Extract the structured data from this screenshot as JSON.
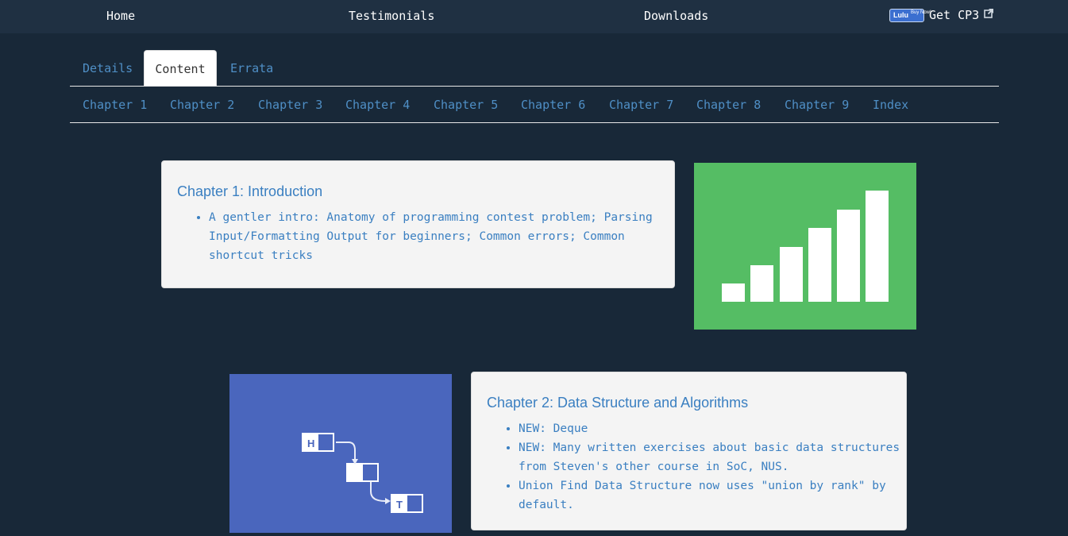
{
  "topnav": {
    "home": "Home",
    "testimonials": "Testimonials",
    "downloads": "Downloads",
    "lulu_logo": "Lulu",
    "lulu_buy": "Buy Now!",
    "get_cp3": "Get CP3",
    "external_icon": "external-link-icon"
  },
  "tabs": [
    "Details",
    "Content",
    "Errata"
  ],
  "active_tab": "Content",
  "chapters": [
    "Chapter 1",
    "Chapter 2",
    "Chapter 3",
    "Chapter 4",
    "Chapter 5",
    "Chapter 6",
    "Chapter 7",
    "Chapter 8",
    "Chapter 9",
    "Index"
  ],
  "chapter1": {
    "title": "Chapter 1: Introduction",
    "items": [
      "A gentler intro: Anatomy of programming contest problem; Parsing Input/Formatting Output for beginners; Common errors; Common shortcut tricks"
    ],
    "image": {
      "icon": "bar-chart-icon",
      "color": "#55bd64"
    }
  },
  "chapter2": {
    "title": "Chapter 2: Data Structure and Algorithms",
    "items": [
      "NEW: Deque",
      "NEW: Many written exercises about basic data structures from Steven's other course in SoC, NUS.",
      "Union Find Data Structure now uses \"union by rank\" by default."
    ],
    "image": {
      "icon": "linked-list-icon",
      "color": "#4a66bd",
      "head_label": "H",
      "tail_label": "T"
    }
  }
}
